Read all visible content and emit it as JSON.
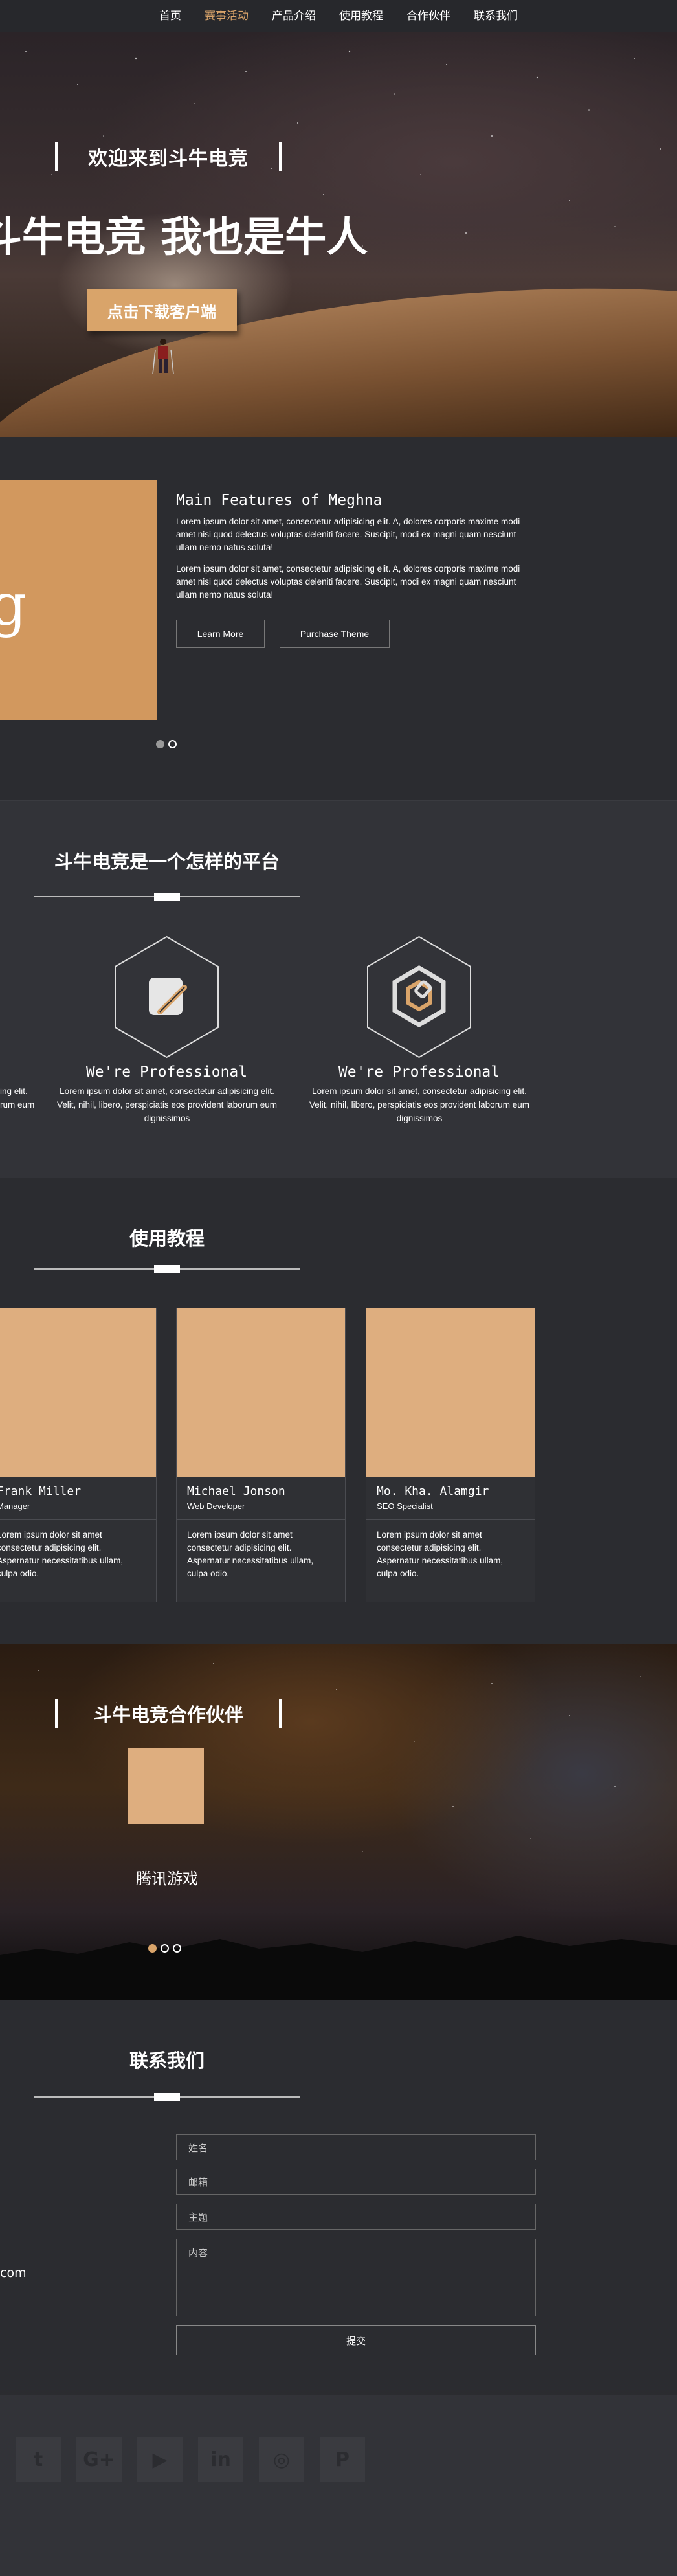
{
  "nav": {
    "items": [
      {
        "label": "首页"
      },
      {
        "label": "赛事活动"
      },
      {
        "label": "产品介绍"
      },
      {
        "label": "使用教程"
      },
      {
        "label": "合作伙伴"
      },
      {
        "label": "联系我们"
      }
    ],
    "active_index": 1,
    "active_color": "#d9a46a"
  },
  "hero": {
    "welcome": "欢迎来到斗牛电竞",
    "headline": "斗牛电竞 我也是牛人",
    "download_button": "点击下载客户端"
  },
  "features": {
    "image_letter": "g",
    "title": "Main Features of Meghna",
    "paragraph1": "Lorem ipsum dolor sit amet, consectetur adipisicing elit. A, dolores corporis maxime modi amet nisi quod delectus voluptas deleniti facere. Suscipit, modi ex magni quam nesciunt ullam nemo natus soluta!",
    "paragraph2": "Lorem ipsum dolor sit amet, consectetur adipisicing elit. A, dolores corporis maxime modi amet nisi quod delectus voluptas deleniti facere. Suscipit, modi ex magni quam nesciunt ullam nemo natus soluta!",
    "learn_more": "Learn More",
    "purchase": "Purchase Theme"
  },
  "platform": {
    "title": "斗牛电竞是一个怎样的平台",
    "left_fragment_line1": "ing elit.",
    "left_fragment_line2": "rum eum",
    "cards": [
      {
        "icon": "edit-icon",
        "title": "We're Professional",
        "text": "Lorem ipsum dolor sit amet, consectetur adipisicing elit. Velit, nihil, libero, perspiciatis eos provident laborum eum dignissimos"
      },
      {
        "icon": "link-icon",
        "title": "We're Professional",
        "text": "Lorem ipsum dolor sit amet, consectetur adipisicing elit. Velit, nihil, libero, perspiciatis eos provident laborum eum dignissimos"
      }
    ]
  },
  "tutorial": {
    "title": "使用教程",
    "members": [
      {
        "name": "Frank Miller",
        "role": "Manager",
        "bio": "Lorem ipsum dolor sit amet consectetur adipisicing elit. Aspernatur necessitatibus ullam, culpa odio."
      },
      {
        "name": "Michael Jonson",
        "role": "Web Developer",
        "bio": "Lorem ipsum dolor sit amet consectetur adipisicing elit. Aspernatur necessitatibus ullam, culpa odio."
      },
      {
        "name": "Mo. Kha. Alamgir",
        "role": "SEO Specialist",
        "bio": "Lorem ipsum dolor sit amet consectetur adipisicing elit. Aspernatur necessitatibus ullam, culpa odio."
      }
    ]
  },
  "partners": {
    "title": "斗牛电竞合作伙伴",
    "partner_name": "腾讯游戏"
  },
  "contact": {
    "title": "联系我们",
    "email_fragment": "com",
    "name_placeholder": "姓名",
    "email_placeholder": "邮箱",
    "subject_placeholder": "主题",
    "content_placeholder": "内容",
    "submit": "提交"
  },
  "footer": {
    "social": [
      {
        "icon": "twitter-icon",
        "glyph": "t"
      },
      {
        "icon": "google-plus-icon",
        "glyph": "G+"
      },
      {
        "icon": "youtube-icon",
        "glyph": "▶"
      },
      {
        "icon": "linkedin-icon",
        "glyph": "in"
      },
      {
        "icon": "dribbble-icon",
        "glyph": "◎"
      },
      {
        "icon": "pinterest-icon",
        "glyph": "P"
      }
    ]
  },
  "colors": {
    "accent": "#d9a46a",
    "card_image": "#deae7f",
    "background": "#2b2c30"
  }
}
